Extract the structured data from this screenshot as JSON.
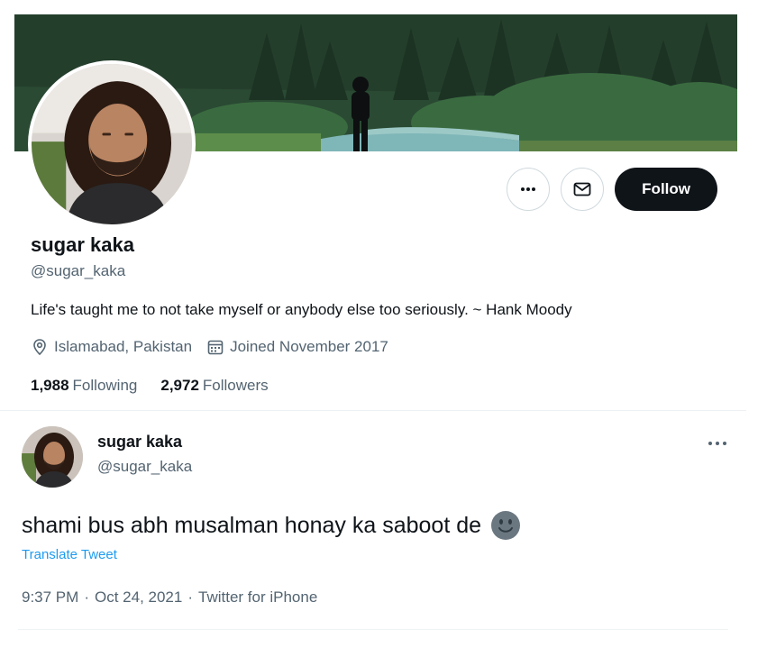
{
  "profile": {
    "display_name": "sugar kaka",
    "handle": "@sugar_kaka",
    "bio": "Life's taught me to not take myself or anybody else too seriously. ~ Hank Moody",
    "location": "Islamabad, Pakistan",
    "joined": "Joined November 2017",
    "following_count": "1,988",
    "following_label": "Following",
    "followers_count": "2,972",
    "followers_label": "Followers",
    "follow_label": "Follow",
    "more_icon": "more-horizontal-icon",
    "message_icon": "envelope-icon",
    "location_icon": "location-pin-icon",
    "calendar_icon": "calendar-icon"
  },
  "tweet": {
    "display_name": "sugar kaka",
    "handle": "@sugar_kaka",
    "text": "shami bus abh musalman honay ka saboot de",
    "emoji": "slightly-smiling-face-icon",
    "translate_label": "Translate Tweet",
    "time": "9:37 PM",
    "date": "Oct 24, 2021",
    "source": "Twitter for iPhone",
    "separator": "·"
  },
  "colors": {
    "primary_text": "#0f1419",
    "secondary_text": "#536471",
    "link": "#1d9bf0",
    "follow_button": "#0f1419",
    "border": "#cfd9de"
  }
}
